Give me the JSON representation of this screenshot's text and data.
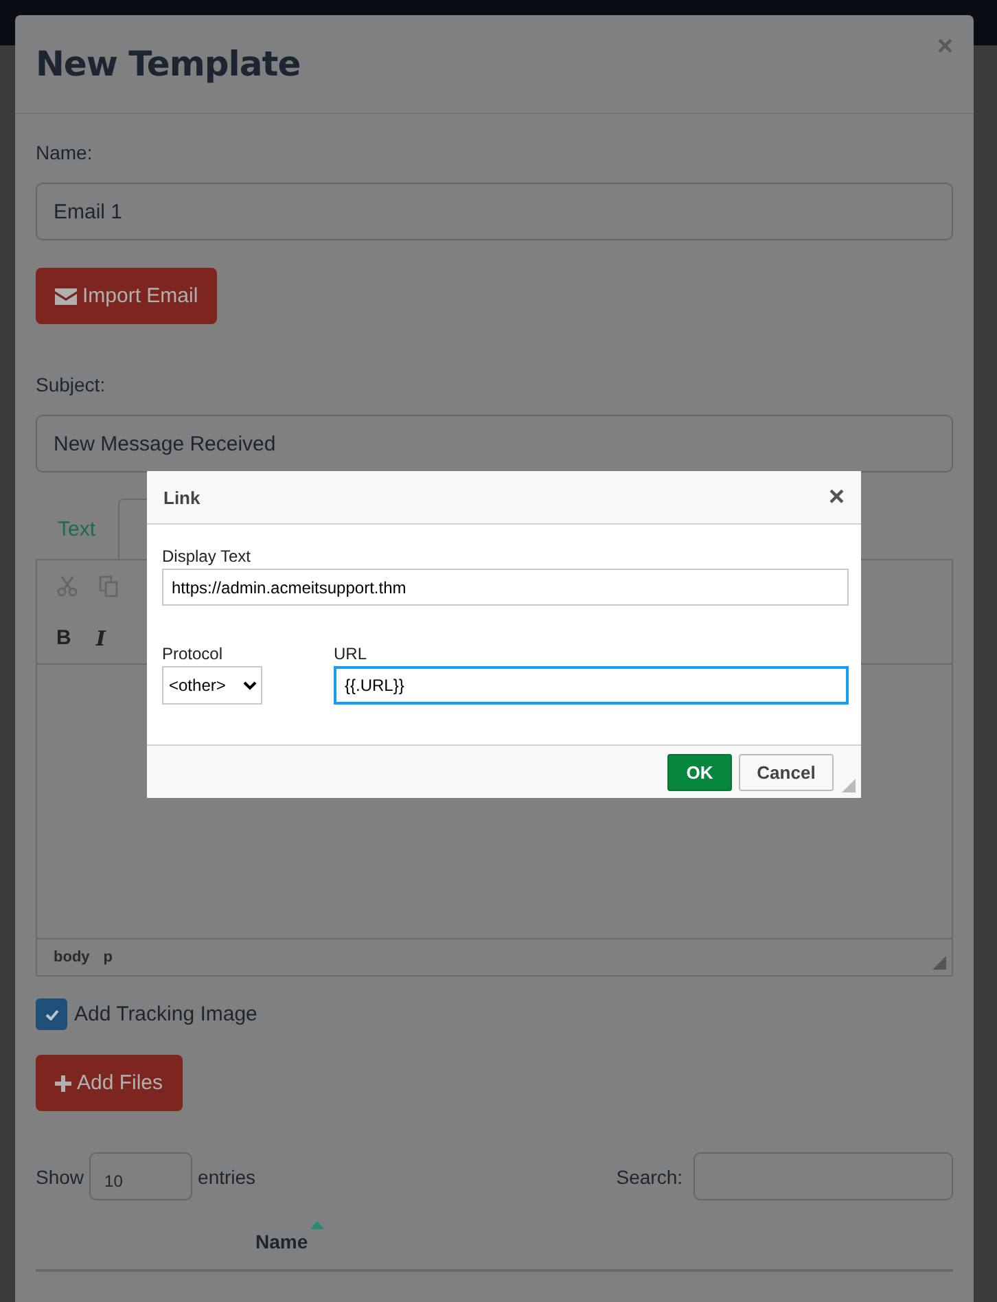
{
  "modal": {
    "title": "New Template",
    "close": "×"
  },
  "name_field": {
    "label": "Name:",
    "value": "Email 1"
  },
  "import_button": {
    "label": "Import Email"
  },
  "subject_field": {
    "label": "Subject:",
    "value": "New Message Received"
  },
  "editor": {
    "tabs": [
      {
        "label": "Text",
        "selected": false
      },
      {
        "selected": true
      }
    ],
    "toolbar": [
      "B",
      "I"
    ],
    "status_path": [
      "body",
      "p"
    ]
  },
  "tracking": {
    "label": "Add Tracking Image",
    "checked": true
  },
  "add_files_button": {
    "label": "Add Files"
  },
  "table": {
    "length_prefix": "Show",
    "length_value": "10",
    "length_suffix": "entries",
    "search_label": "Search:",
    "columns": [
      {
        "label": "Name",
        "sorted": true
      }
    ]
  },
  "link_dialog": {
    "title": "Link",
    "close": "×",
    "display_text": {
      "label": "Display Text",
      "value": "https://admin.acmeitsupport.thm"
    },
    "protocol": {
      "label": "Protocol",
      "value": "<other>"
    },
    "url": {
      "label": "URL",
      "value": "{{.URL}}",
      "focused": true
    },
    "buttons": [
      {
        "label": "OK",
        "kind": "primary"
      },
      {
        "label": "Cancel",
        "kind": "secondary"
      }
    ]
  }
}
